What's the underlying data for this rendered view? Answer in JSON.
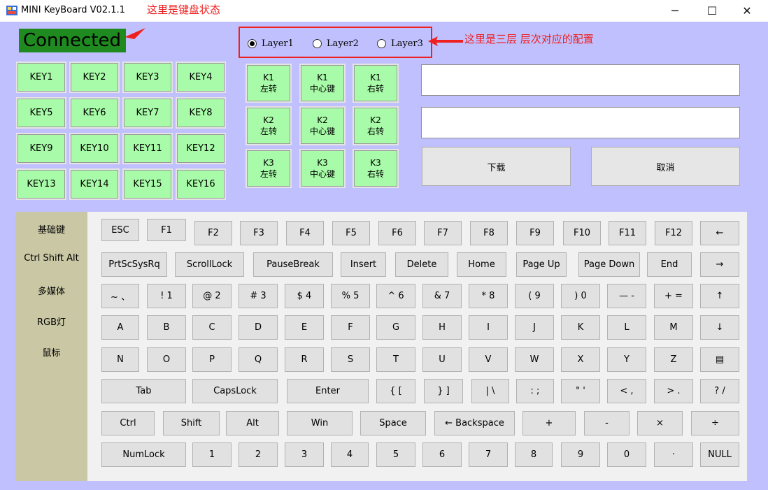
{
  "window": {
    "title": "MINI KeyBoard V02.1.1",
    "controls": {
      "minimize": "─",
      "maximize": "☐",
      "close": "✕"
    }
  },
  "annotations": {
    "status_note": "这里是键盘状态",
    "layer_note": "这里是三层 层次对应的配置"
  },
  "status": {
    "text": "Connected"
  },
  "layers": {
    "options": [
      "Layer1",
      "Layer2",
      "Layer3"
    ],
    "selected": "Layer1"
  },
  "grid_keys": [
    "KEY1",
    "KEY2",
    "KEY3",
    "KEY4",
    "KEY5",
    "KEY6",
    "KEY7",
    "KEY8",
    "KEY9",
    "KEY10",
    "KEY11",
    "KEY12",
    "KEY13",
    "KEY14",
    "KEY15",
    "KEY16"
  ],
  "knobs": [
    {
      "id": "K1",
      "left": "左转",
      "center": "中心键",
      "right": "右转"
    },
    {
      "id": "K2",
      "left": "左转",
      "center": "中心键",
      "right": "右转"
    },
    {
      "id": "K3",
      "left": "左转",
      "center": "中心键",
      "right": "右转"
    }
  ],
  "inputs": {
    "field1": "",
    "field2": ""
  },
  "actions": {
    "download": "下载",
    "cancel": "取消"
  },
  "sidebar": [
    "基础键",
    "Ctrl Shift Alt",
    "多媒体",
    "RGB灯",
    "鼠标"
  ],
  "keyboard": {
    "row1": [
      "ESC",
      "F1",
      "F2",
      "F3",
      "F4",
      "F5",
      "F6",
      "F7",
      "F8",
      "F9",
      "F10",
      "F11",
      "F12",
      "←"
    ],
    "row2": [
      "PrtScSysRq",
      "ScrollLock",
      "PauseBreak",
      "Insert",
      "Delete",
      "Home",
      "Page Up",
      "Page Down",
      "End",
      "→"
    ],
    "row3": [
      "~ 、",
      "! 1",
      "@ 2",
      "# 3",
      "$ 4",
      "% 5",
      "^ 6",
      "& 7",
      "* 8",
      "( 9",
      ") 0",
      "— -",
      "+ =",
      "↑"
    ],
    "row4": [
      "A",
      "B",
      "C",
      "D",
      "E",
      "F",
      "G",
      "H",
      "I",
      "J",
      "K",
      "L",
      "M",
      "↓"
    ],
    "row5": [
      "N",
      "O",
      "P",
      "Q",
      "R",
      "S",
      "T",
      "U",
      "V",
      "W",
      "X",
      "Y",
      "Z",
      "▤"
    ],
    "row6": [
      "Tab",
      "CapsLock",
      "Enter",
      "{ [",
      "} ]",
      "| \\",
      ": ;",
      "\" '",
      "< ,",
      "> .",
      "? /"
    ],
    "row7": [
      "Ctrl",
      "Shift",
      "Alt",
      "Win",
      "Space",
      "← Backspace",
      "+",
      "-",
      "×",
      "÷"
    ],
    "row8": [
      "NumLock",
      "1",
      "2",
      "3",
      "4",
      "5",
      "6",
      "7",
      "8",
      "9",
      "0",
      "·",
      "NULL"
    ]
  },
  "colors": {
    "client_bg": "#c0c0fe",
    "key_green": "#a8fba8",
    "status_green": "#1f8a1f",
    "annotation_red": "#ef1c1c",
    "sidebar_bg": "#c9c7a4"
  }
}
